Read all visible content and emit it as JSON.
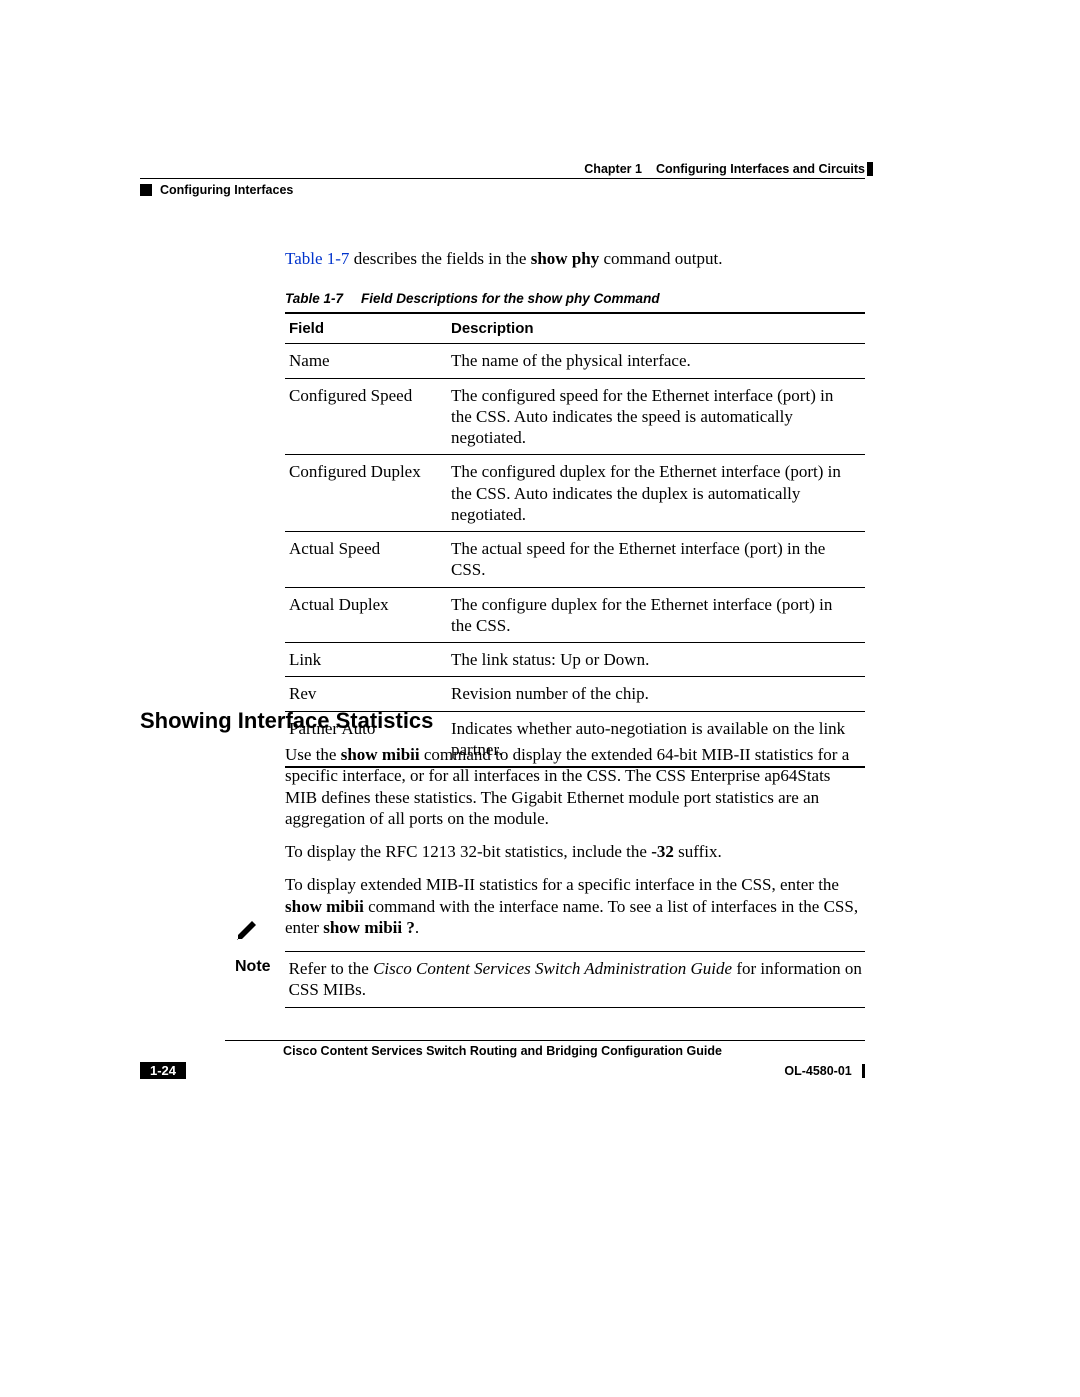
{
  "header": {
    "chapter_label": "Chapter 1",
    "chapter_title": "Configuring Interfaces and Circuits",
    "section_title": "Configuring Interfaces"
  },
  "intro": {
    "link_text": "Table 1-7",
    "rest_1": " describes the fields in the ",
    "cmd": "show phy",
    "rest_2": " command output."
  },
  "table": {
    "caption_num": "Table 1-7",
    "caption_title": "Field Descriptions for the show phy Command",
    "col1": "Field",
    "col2": "Description",
    "rows": [
      {
        "field": "Name",
        "desc": "The name of the physical interface."
      },
      {
        "field": "Configured Speed",
        "desc": "The configured speed for the Ethernet interface (port) in the CSS. Auto indicates the speed is automatically negotiated."
      },
      {
        "field": "Configured Duplex",
        "desc": "The configured duplex for the Ethernet interface (port) in the CSS. Auto indicates the duplex is automatically negotiated."
      },
      {
        "field": "Actual Speed",
        "desc": "The actual speed for the Ethernet interface (port) in the CSS."
      },
      {
        "field": "Actual Duplex",
        "desc": "The configure duplex for the Ethernet interface (port) in the CSS."
      },
      {
        "field": "Link",
        "desc": "The link status: Up or Down."
      },
      {
        "field": "Rev",
        "desc": "Revision number of the chip."
      },
      {
        "field": "Partner Auto",
        "desc": "Indicates whether auto-negotiation is available on the link partner."
      }
    ]
  },
  "heading2": "Showing Interface Statistics",
  "para1": {
    "t1": "Use the ",
    "b1": "show mibii",
    "t2": " command to display the extended 64-bit MIB-II statistics for a specific interface, or for all interfaces in the CSS. The CSS Enterprise ap64Stats MIB defines these statistics. The Gigabit Ethernet module port statistics are an aggregation of all ports on the module."
  },
  "para2": {
    "t1": "To display the RFC 1213 32-bit statistics, include the ",
    "b1": "-32",
    "t2": " suffix."
  },
  "para3": {
    "t1": "To display extended MIB-II statistics for a specific interface in the CSS, enter the ",
    "b1": "show mibii",
    "t2": " command with the interface name. To see a list of interfaces in the CSS, enter ",
    "b2": "show mibii ?",
    "t3": "."
  },
  "note": {
    "label": "Note",
    "t1": "Refer to the ",
    "i1": "Cisco Content Services Switch Administration Guide",
    "t2": " for information on CSS MIBs."
  },
  "footer": {
    "book_title": "Cisco Content Services Switch Routing and Bridging Configuration Guide",
    "page_num": "1-24",
    "doc_id": "OL-4580-01"
  }
}
